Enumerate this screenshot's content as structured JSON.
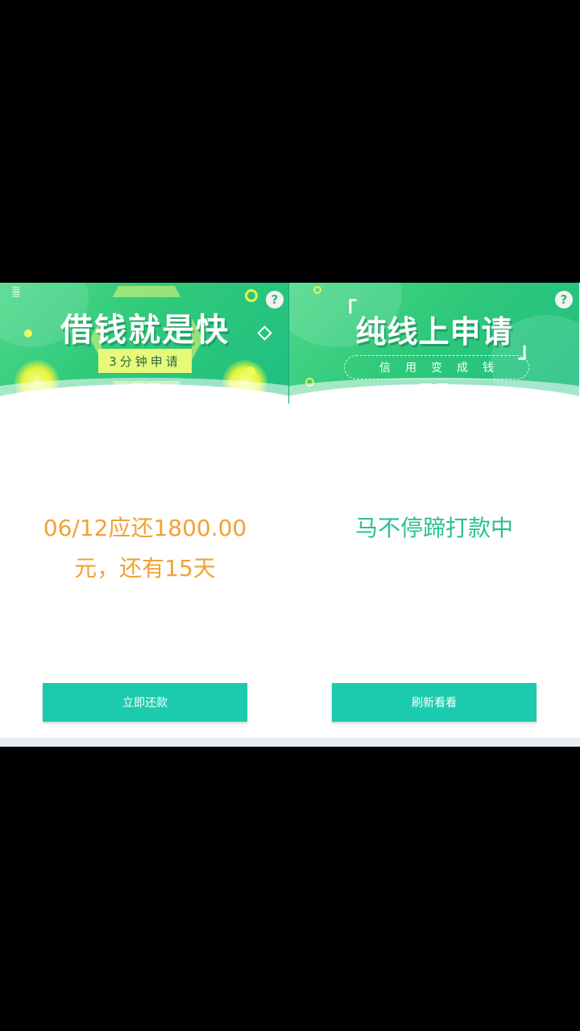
{
  "left_screen": {
    "banner": {
      "headline": "借钱就是快",
      "subtitle": "3分钟申请"
    },
    "help_label": "?",
    "message_line1": "06/12应还1800.00",
    "message_line2": "元，还有15天",
    "button_label": "立即还款"
  },
  "right_screen": {
    "banner": {
      "headline": "纯线上申请",
      "subtitle": "信用变成钱"
    },
    "help_label": "?",
    "message": "马不停蹄打款中",
    "button_label": "刷新看看"
  },
  "colors": {
    "banner_green": "#2fc97a",
    "button_teal": "#1ccbad",
    "amount_orange": "#f0a236",
    "status_teal": "#2cbf97"
  }
}
